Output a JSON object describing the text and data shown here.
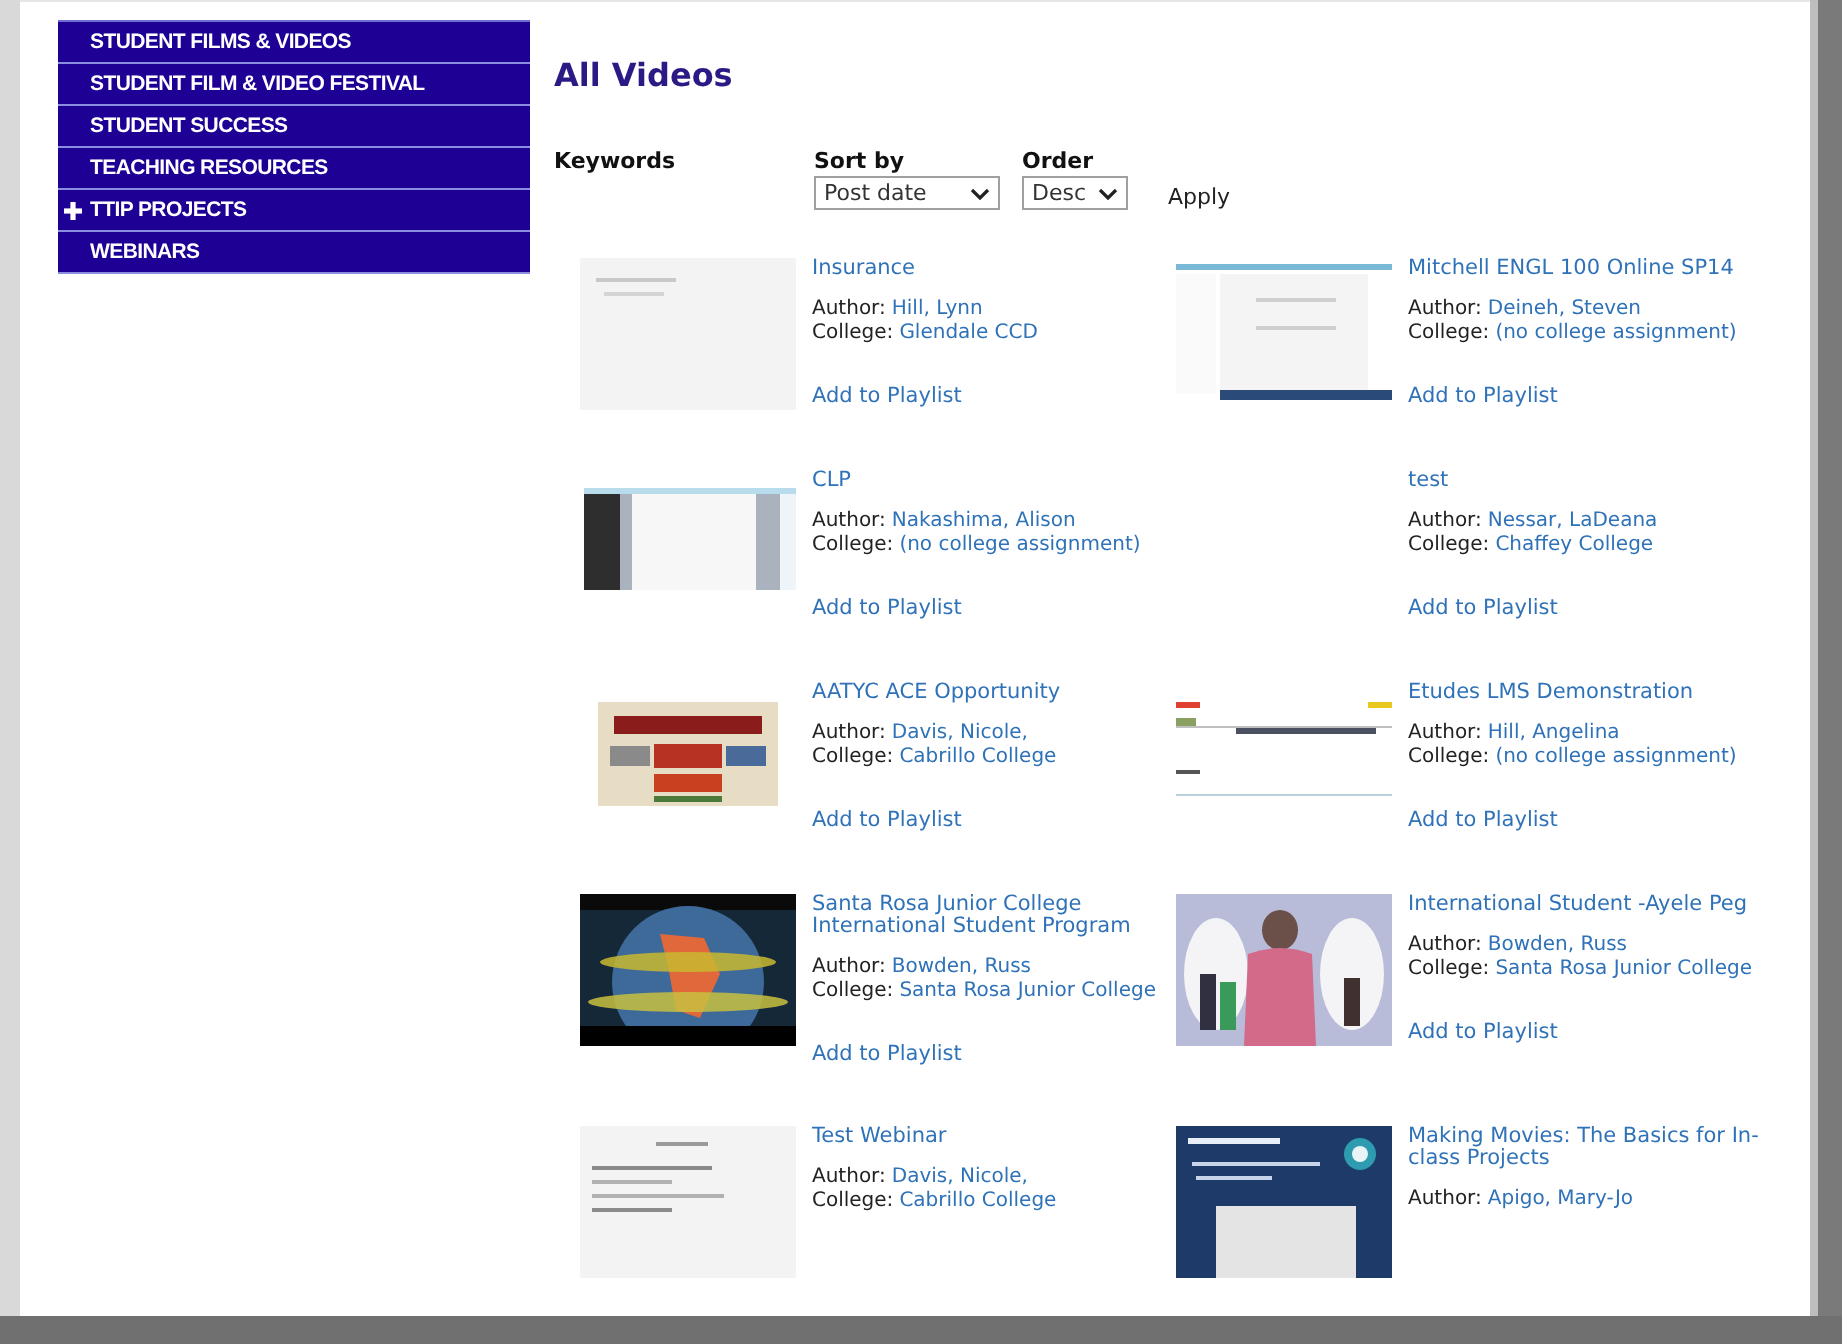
{
  "sidebar": {
    "items": [
      {
        "label": "STUDENT FILMS & VIDEOS",
        "expandable": false
      },
      {
        "label": "STUDENT FILM & VIDEO FESTIVAL",
        "expandable": false
      },
      {
        "label": "STUDENT SUCCESS",
        "expandable": false
      },
      {
        "label": "TEACHING RESOURCES",
        "expandable": false
      },
      {
        "label": "TTIP PROJECTS",
        "expandable": true
      },
      {
        "label": "WEBINARS",
        "expandable": false
      }
    ]
  },
  "page_title": "All Videos",
  "filters": {
    "keywords_label": "Keywords",
    "sort_label": "Sort by",
    "sort_value": "Post date",
    "order_label": "Order",
    "order_value": "Desc",
    "apply": "Apply"
  },
  "videos": [
    {
      "title": "Insurance",
      "author_label": "Author:",
      "author": "Hill, Lynn",
      "college_label": "College:",
      "college": "Glendale CCD",
      "action": "Add to Playlist",
      "picture": true
    },
    {
      "title": "Mitchell ENGL 100 Online SP14",
      "author_label": "Author:",
      "author": "Deineh, Steven",
      "college_label": "College:",
      "college": "(no college assignment)",
      "action": "Add to Playlist",
      "picture": true
    },
    {
      "title": "CLP",
      "author_label": "Author:",
      "author": "Nakashima, Alison",
      "college_label": "College:",
      "college": "(no college assignment)",
      "action": "Add to Playlist",
      "picture": true
    },
    {
      "title": "test",
      "author_label": "Author:",
      "author": "Nessar, LaDeana",
      "college_label": "College:",
      "college": "Chaffey College",
      "action": "Add to Playlist"
    },
    {
      "title": "AATYC ACE Opportunity",
      "author_label": "Author:",
      "author": "Davis, Nicole,",
      "college_label": "College:",
      "college": "Cabrillo College",
      "action": "Add to Playlist",
      "picture": true
    },
    {
      "title": "Etudes LMS Demonstration",
      "author_label": "Author:",
      "author": "Hill, Angelina",
      "college_label": "College:",
      "college": "(no college assignment)",
      "action": "Add to Playlist",
      "picture": true
    },
    {
      "title": "Santa Rosa Junior College International Student Program",
      "author_label": "Author:",
      "author": "Bowden, Russ",
      "college_label": "College:",
      "college": "Santa Rosa Junior College",
      "action": "Add to Playlist",
      "picture": true
    },
    {
      "title": "International Student -Ayele Peg",
      "author_label": "Author:",
      "author": "Bowden, Russ",
      "college_label": "College:",
      "college": "Santa Rosa Junior College",
      "action": "Add to Playlist",
      "picture": true
    },
    {
      "title": "Test Webinar",
      "author_label": "Author:",
      "author": "Davis, Nicole,",
      "college_label": "College:",
      "college": "Cabrillo College",
      "picture": true
    },
    {
      "title": "Making Movies: The Basics for In-class Projects",
      "author_label": "Author:",
      "author": "Apigo, Mary-Jo",
      "picture": true
    }
  ]
}
